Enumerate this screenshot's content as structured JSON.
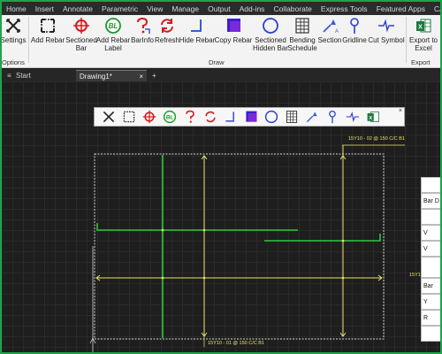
{
  "menubar": {
    "items": [
      "Home",
      "Insert",
      "Annotate",
      "Parametric",
      "View",
      "Manage",
      "Output",
      "Add-ins",
      "Collaborate",
      "Express Tools",
      "Featured Apps",
      "CADTakeO"
    ]
  },
  "ribbon": {
    "buttons": [
      {
        "label": "Settings",
        "icon": "gear-cross-icon"
      },
      {
        "label": "Add Rebar",
        "icon": "add-rebar-icon"
      },
      {
        "label": "Sectioned\nBar",
        "icon": "crosshair-icon"
      },
      {
        "label": "Add Rebar\nLabel",
        "icon": "bl-label-icon"
      },
      {
        "label": "BarInfo",
        "icon": "question-icon"
      },
      {
        "label": "Refresh",
        "icon": "refresh-icon"
      },
      {
        "label": "Hide Rebar",
        "icon": "hide-rebar-icon"
      },
      {
        "label": "Copy Rebar",
        "icon": "copy-square-icon"
      },
      {
        "label": "Sectioned\nHidden Bar",
        "icon": "circle-icon"
      },
      {
        "label": "Bending\nSchedule",
        "icon": "table-icon"
      },
      {
        "label": "Section",
        "icon": "section-icon"
      },
      {
        "label": "Gridline",
        "icon": "gridline-icon"
      },
      {
        "label": "Cut Symbol",
        "icon": "cut-symbol-icon"
      },
      {
        "label": "Export to\nExcel",
        "icon": "excel-icon"
      }
    ],
    "groups": {
      "options": "Options",
      "draw": "Draw",
      "export": "Export"
    }
  },
  "tabs": {
    "start": "Start",
    "drawing": "Drawing1*",
    "add": "+"
  },
  "drawing": {
    "label_top": "15Y10 - 02 @ 150 C/C B1",
    "label_bottom": "15Y10 - 01 @ 150 C/C B1",
    "label_right": "15Y10 - 03 @"
  },
  "side_table": {
    "cells": [
      "Bar D",
      "V",
      "V",
      "Bar",
      "Y",
      "R"
    ]
  },
  "colors": {
    "rebar": "#2fc73a",
    "dimension": "#e9e36b",
    "accent_frame": "#1fa34a"
  }
}
